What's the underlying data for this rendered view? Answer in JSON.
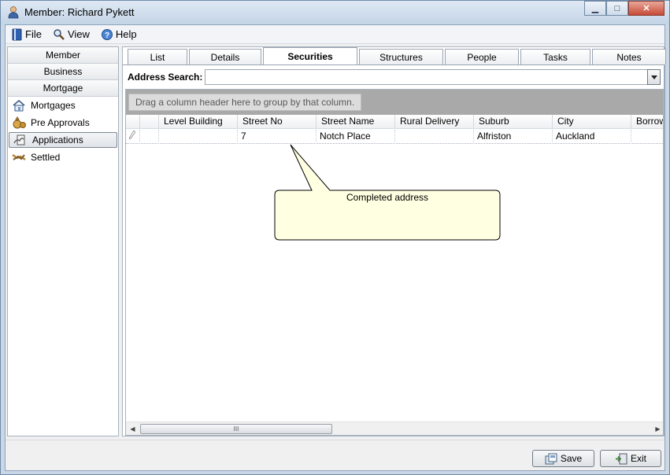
{
  "window": {
    "title": "Member: Richard Pykett",
    "controls": {
      "minimize": "▁",
      "maximize": "□",
      "close": "✕"
    }
  },
  "menu": {
    "file": "File",
    "view": "View",
    "help": "Help"
  },
  "nav": {
    "groups": [
      "Member",
      "Business",
      "Mortgage"
    ],
    "items": [
      {
        "label": "Mortgages",
        "icon": "house-icon"
      },
      {
        "label": "Pre Approvals",
        "icon": "money-bag-icon"
      },
      {
        "label": "Applications",
        "icon": "application-icon",
        "selected": true
      },
      {
        "label": "Settled",
        "icon": "handshake-icon"
      }
    ]
  },
  "tabs": [
    "List",
    "Details",
    "Securities",
    "Structures",
    "People",
    "Tasks",
    "Notes"
  ],
  "active_tab": "Securities",
  "address_search": {
    "label": "Address Search:",
    "value": ""
  },
  "grid": {
    "group_hint": "Drag a column header here to group by that column.",
    "columns": [
      "Level Building",
      "Street No",
      "Street Name",
      "Rural Delivery",
      "Suburb",
      "City",
      "Borrowe"
    ],
    "rows": [
      [
        "",
        "7",
        "Notch Place",
        "",
        "Alfriston",
        "Auckland",
        ""
      ]
    ],
    "scroll_thumb": "III"
  },
  "callout": {
    "text": "Completed address"
  },
  "buttons": {
    "save": "Save",
    "exit": "Exit"
  },
  "colors": {
    "titlebar": "#c3d4e6",
    "group_panel": "#a9a9a9",
    "callout_fill": "#ffffe1"
  }
}
